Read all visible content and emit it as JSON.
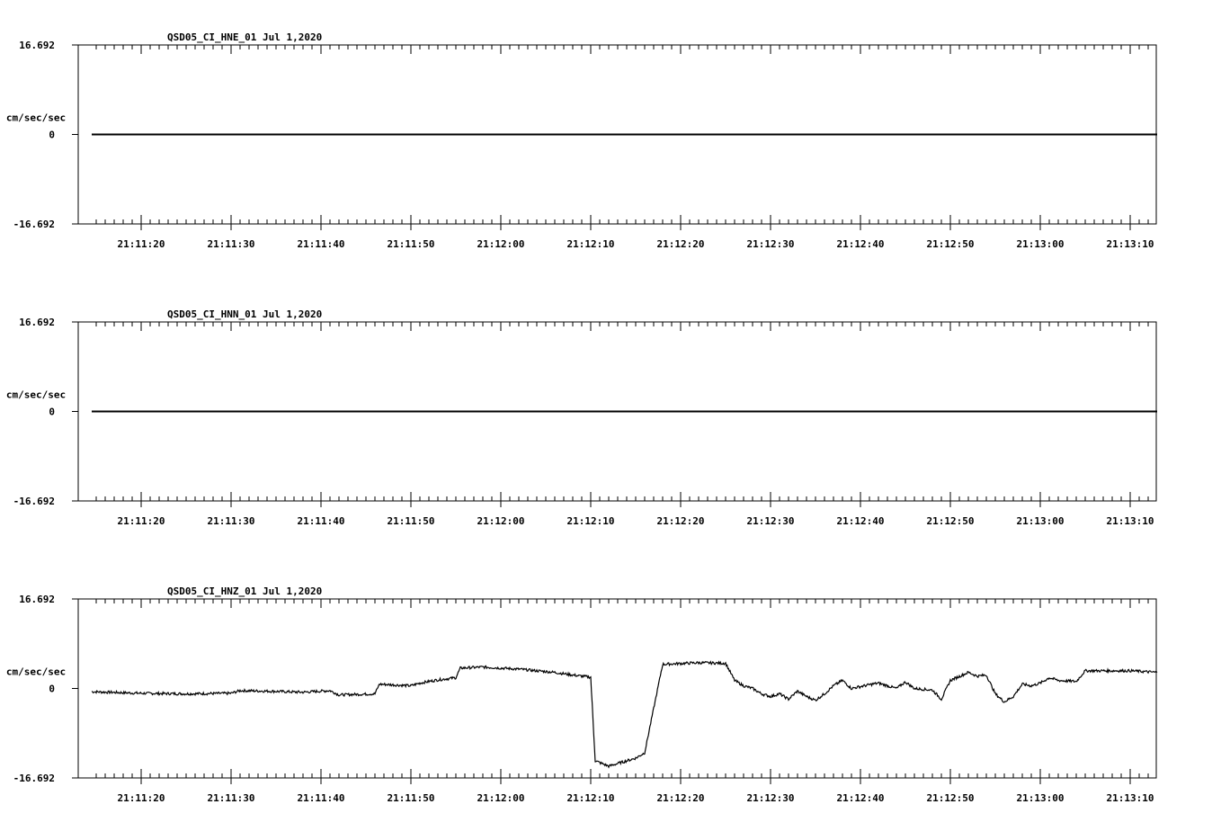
{
  "chart_data": [
    {
      "type": "line",
      "title": "QSD05_CI_HNE_01  Jul 1,2020",
      "ylabel": "cm/sec/sec",
      "y_ticks": [
        "16.692",
        "0",
        "-16.692"
      ],
      "ylim": [
        -16.692,
        16.692
      ],
      "xlim": [
        "21:11:14.5",
        "21:13:13"
      ],
      "x_ticks": [
        "21:11:20",
        "21:11:30",
        "21:11:40",
        "21:11:50",
        "21:12:00",
        "21:12:10",
        "21:12:20",
        "21:12:30",
        "21:12:40",
        "21:12:50",
        "21:13:00",
        "21:13:10"
      ],
      "series": [
        {
          "points": [
            [
              -5.5,
              0.0
            ],
            [
              113.0,
              0.0
            ]
          ]
        }
      ]
    },
    {
      "type": "line",
      "title": "QSD05_CI_HNN_01  Jul 1,2020",
      "ylabel": "cm/sec/sec",
      "y_ticks": [
        "16.692",
        "0",
        "-16.692"
      ],
      "ylim": [
        -16.692,
        16.692
      ],
      "xlim": [
        "21:11:14.5",
        "21:13:13"
      ],
      "x_ticks": [
        "21:11:20",
        "21:11:30",
        "21:11:40",
        "21:11:50",
        "21:12:00",
        "21:12:10",
        "21:12:20",
        "21:12:30",
        "21:12:40",
        "21:12:50",
        "21:13:00",
        "21:13:10"
      ],
      "series": [
        {
          "points": [
            [
              -5.5,
              0.0
            ],
            [
              113.0,
              0.0
            ]
          ]
        }
      ]
    },
    {
      "type": "line",
      "title": "QSD05_CI_HNZ_01  Jul 1,2020",
      "ylabel": "cm/sec/sec",
      "y_ticks": [
        "16.692",
        "0",
        "-16.692"
      ],
      "ylim": [
        -16.692,
        16.692
      ],
      "xlim": [
        "21:11:14.5",
        "21:13:13"
      ],
      "x_ticks": [
        "21:11:20",
        "21:11:30",
        "21:11:40",
        "21:11:50",
        "21:12:00",
        "21:12:10",
        "21:12:20",
        "21:12:30",
        "21:12:40",
        "21:12:50",
        "21:13:00",
        "21:13:10"
      ],
      "series": [
        {
          "points": [
            [
              -5.5,
              -0.6
            ],
            [
              0,
              -0.9
            ],
            [
              5,
              -1.0
            ],
            [
              10,
              -0.9
            ],
            [
              11,
              -0.4
            ],
            [
              14,
              -0.5
            ],
            [
              18,
              -0.7
            ],
            [
              21,
              -0.4
            ],
            [
              22,
              -1.2
            ],
            [
              26,
              -1.0
            ],
            [
              26.5,
              0.8
            ],
            [
              30,
              0.5
            ],
            [
              31,
              1.0
            ],
            [
              33,
              1.6
            ],
            [
              35,
              2.0
            ],
            [
              35.5,
              3.8
            ],
            [
              38,
              4.0
            ],
            [
              42,
              3.6
            ],
            [
              46,
              3.0
            ],
            [
              48,
              2.5
            ],
            [
              50,
              2.1
            ],
            [
              50.5,
              -13.5
            ],
            [
              52,
              -14.5
            ],
            [
              55,
              -13.0
            ],
            [
              56,
              -12.0
            ],
            [
              58,
              4.5
            ],
            [
              62,
              4.8
            ],
            [
              65,
              4.7
            ],
            [
              66,
              1.5
            ],
            [
              67,
              0.5
            ],
            [
              68,
              0.0
            ],
            [
              69,
              -1.0
            ],
            [
              70,
              -1.5
            ],
            [
              71,
              -1.0
            ],
            [
              72,
              -2.0
            ],
            [
              73,
              -0.5
            ],
            [
              74,
              -1.5
            ],
            [
              75,
              -2.2
            ],
            [
              76,
              -1.0
            ],
            [
              77,
              0.5
            ],
            [
              78,
              1.5
            ],
            [
              79,
              0.0
            ],
            [
              81,
              0.7
            ],
            [
              82,
              1.0
            ],
            [
              84,
              0.0
            ],
            [
              85,
              1.2
            ],
            [
              86,
              0.0
            ],
            [
              88,
              -0.3
            ],
            [
              89,
              -2.0
            ],
            [
              90,
              1.5
            ],
            [
              92,
              3.0
            ],
            [
              93,
              2.3
            ],
            [
              94,
              2.5
            ],
            [
              95,
              -1.0
            ],
            [
              96,
              -2.5
            ],
            [
              97,
              -1.5
            ],
            [
              98,
              0.8
            ],
            [
              99,
              0.5
            ],
            [
              100,
              1.0
            ],
            [
              101,
              2.0
            ],
            [
              102,
              1.5
            ],
            [
              104,
              1.3
            ],
            [
              105,
              3.3
            ],
            [
              110,
              3.3
            ],
            [
              113,
              3.0
            ]
          ]
        }
      ]
    }
  ]
}
